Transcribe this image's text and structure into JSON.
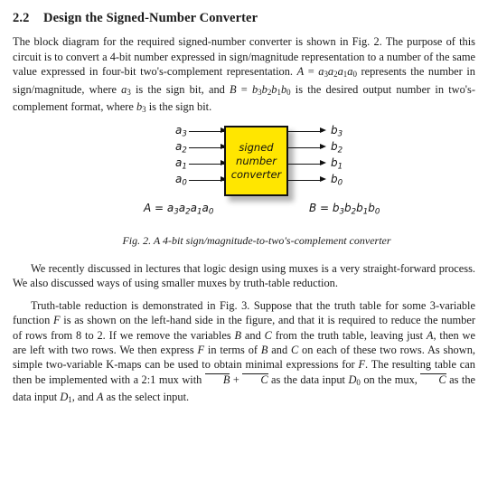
{
  "document": {
    "section": {
      "number": "2.2",
      "title": "Design the Signed-Number Converter"
    },
    "paragraphs": {
      "p1_a": "The block diagram for the required signed-number converter is shown in Fig. 2. The purpose of this circuit is to convert a 4-bit number expressed in sign/magnitude representation to a number of the same value expressed in four-bit two's-complement representation. ",
      "p1_A": "A",
      "p1_eq": " = ",
      "p1_a3a2a1a0": "a",
      "p1_b": " represents the number in sign/magnitude, where ",
      "p1_a3": "a",
      "p1_c": " is the sign bit, and ",
      "p1_B": "B",
      "p1_d": " is the desired output number in two's-complement format, where ",
      "p1_b3": "b",
      "p1_e": " is the sign bit.",
      "p2": "We recently discussed in lectures that logic design using muxes is a very straight-forward process. We also discussed ways of using smaller muxes by truth-table reduction.",
      "p3_a": "Truth-table reduction is demonstrated in Fig. 3. Suppose that the truth table for some 3-variable function ",
      "p3_F1": "F",
      "p3_b": " is as shown on the left-hand side in the figure, and that it is required to reduce the number of rows from 8 to 2. If we remove the variables ",
      "p3_B": "B",
      "p3_c": " and ",
      "p3_C": "C",
      "p3_d": " from the truth table, leaving just ",
      "p3_A": "A",
      "p3_e": ", then we are left with two rows. We then express ",
      "p3_F2": "F",
      "p3_f": " in terms of ",
      "p3_B2": "B",
      "p3_g": " and ",
      "p3_C2": "C",
      "p3_h": " on each of these two rows. As shown, simple two-variable K-maps can be used to obtain minimal expressions for ",
      "p3_F3": "F",
      "p3_i": ". The resulting table can then be implemented with a 2:1 mux with ",
      "p3_Bbar": "B",
      "p3_plus": " + ",
      "p3_Cbar": "C",
      "p3_j": " as the data input ",
      "p3_D0": "D",
      "p3_D0sub": "0",
      "p3_k": " on the mux, ",
      "p3_Cbar2": "C",
      "p3_l": " as the data input ",
      "p3_D1": "D",
      "p3_D1sub": "1",
      "p3_m": ", and ",
      "p3_A2": "A",
      "p3_n": " as the select input."
    },
    "figure": {
      "box_lines": [
        "signed",
        "number",
        "converter"
      ],
      "inputs": [
        {
          "name": "a",
          "sub": "3"
        },
        {
          "name": "a",
          "sub": "2"
        },
        {
          "name": "a",
          "sub": "1"
        },
        {
          "name": "a",
          "sub": "0"
        }
      ],
      "outputs": [
        {
          "name": "b",
          "sub": "3"
        },
        {
          "name": "b",
          "sub": "2"
        },
        {
          "name": "b",
          "sub": "1"
        },
        {
          "name": "b",
          "sub": "0"
        }
      ],
      "left_equation": {
        "lhs": "A",
        "eq": " = ",
        "terms": [
          {
            "name": "a",
            "sub": "3"
          },
          {
            "name": "a",
            "sub": "2"
          },
          {
            "name": "a",
            "sub": "1"
          },
          {
            "name": "a",
            "sub": "0"
          }
        ]
      },
      "right_equation": {
        "lhs": "B",
        "eq": " = ",
        "terms": [
          {
            "name": "b",
            "sub": "3"
          },
          {
            "name": "b",
            "sub": "2"
          },
          {
            "name": "b",
            "sub": "1"
          },
          {
            "name": "b",
            "sub": "0"
          }
        ]
      },
      "caption": "Fig. 2. A 4-bit sign/magnitude-to-two's-complement converter",
      "box_fill_color": "#FFE600",
      "box_border_color": "#111111"
    }
  }
}
